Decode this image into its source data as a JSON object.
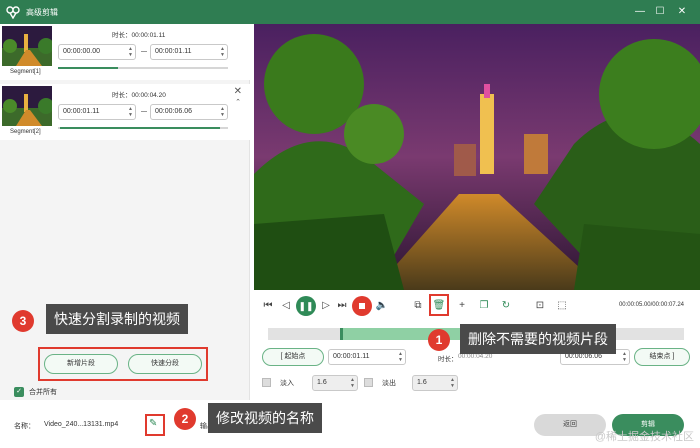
{
  "window": {
    "title": "高级剪辑",
    "minimize": "—",
    "maximize": "☐",
    "close": "✕"
  },
  "segments": [
    {
      "label": "Segment[1]",
      "duration": "时长：00:00:01.11",
      "start": "00:00:00.00",
      "end": "00:00:01.11",
      "progress": 0.35
    },
    {
      "label": "Segment[2]",
      "duration": "时长：00:00:04.20",
      "start": "00:00:01.11",
      "end": "00:00:06.06",
      "progress": 0.9
    }
  ],
  "actions": {
    "new_segment": "新增片段",
    "quick_split": "快速分段",
    "merge_all": "合并所有"
  },
  "controls": {
    "time": "00:00:05.00/00:00:07.24"
  },
  "cut": {
    "start_button": "起始点",
    "start_time": "00:00:01.11",
    "duration_label": "时长：",
    "duration": "00:00:04.20",
    "end_time": "00:00:06.06",
    "end_button": "结束点"
  },
  "fade": {
    "in_label": "淡入",
    "in_value": "1.6",
    "out_label": "淡出",
    "out_value": "1.6"
  },
  "file": {
    "name_label": "名称：",
    "name": "Video_240...13131.mp4",
    "output_label": "输出"
  },
  "footer": {
    "back": "返回",
    "export": "剪辑"
  },
  "annotations": [
    {
      "num": "1",
      "text": "删除不需要的视频片段"
    },
    {
      "num": "2",
      "text": "修改视频的名称"
    },
    {
      "num": "3",
      "text": "快速分割录制的视频"
    }
  ],
  "watermark": "@稀土掘金技术社区",
  "colors": {
    "accent": "#2f7d52",
    "highlight": "#e03a2e"
  }
}
